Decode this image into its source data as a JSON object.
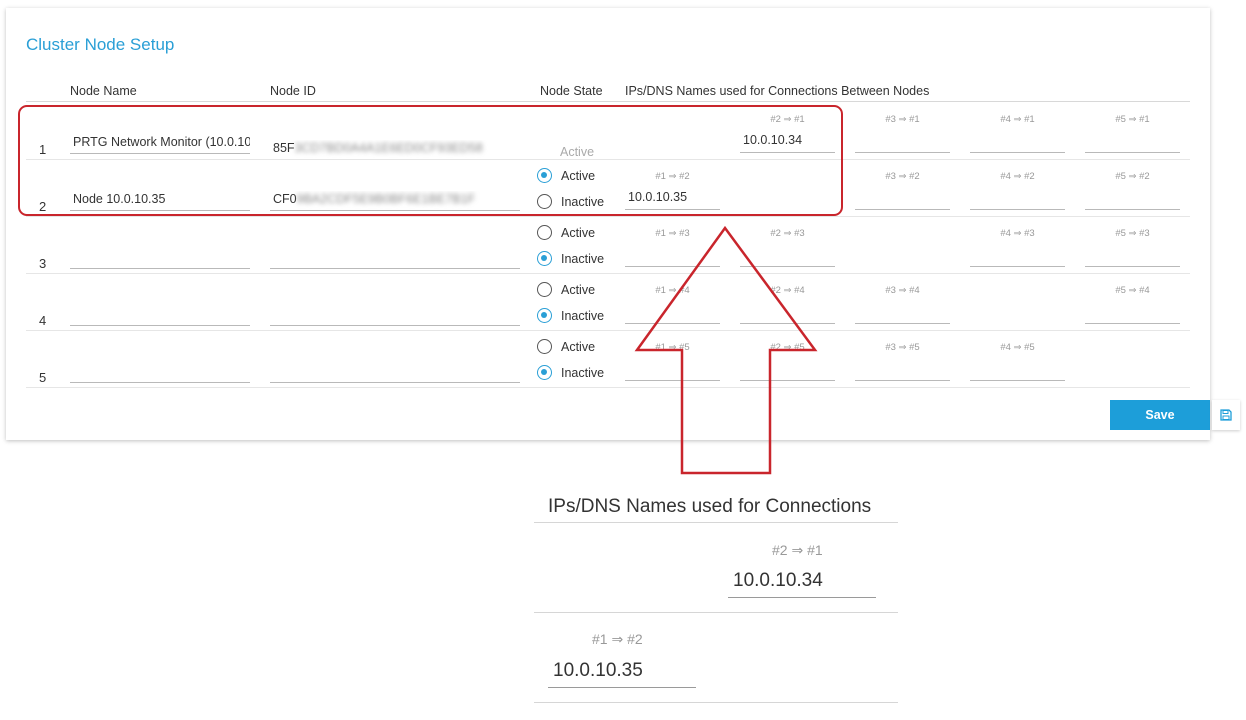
{
  "panel": {
    "title": "Cluster Node Setup",
    "headers": {
      "node_name": "Node Name",
      "node_id": "Node ID",
      "node_state": "Node State",
      "connections": "IPs/DNS Names used for Connections Between Nodes"
    },
    "rows": [
      {
        "num": "1",
        "name": "PRTG Network Monitor (10.0.10",
        "id_prefix": "85F",
        "id_rest": "3CD7BD0A4A1E6ED0CF93ED58",
        "state_static": "Active"
      },
      {
        "num": "2",
        "name": "Node 10.0.10.35",
        "id_prefix": "CF0",
        "id_rest": "9BA2CDF5E9B0BF6E1BE7B1F",
        "state": {
          "active": "Active",
          "inactive": "Inactive"
        }
      },
      {
        "num": "3",
        "name": "",
        "id_prefix": "",
        "state": {
          "active": "Active",
          "inactive": "Inactive"
        }
      },
      {
        "num": "4",
        "name": "",
        "id_prefix": "",
        "state": {
          "active": "Active",
          "inactive": "Inactive"
        }
      },
      {
        "num": "5",
        "name": "",
        "id_prefix": "",
        "state": {
          "active": "Active",
          "inactive": "Inactive"
        }
      }
    ],
    "connections": {
      "r1": {
        "c2": "#2 ⇒ #1",
        "c2v": "10.0.10.34",
        "c3": "#3 ⇒ #1",
        "c4": "#4 ⇒ #1",
        "c5": "#5 ⇒ #1"
      },
      "r2": {
        "c1": "#1 ⇒ #2",
        "c1v": "10.0.10.35",
        "c3": "#3 ⇒ #2",
        "c4": "#4 ⇒ #2",
        "c5": "#5 ⇒ #2"
      },
      "r3": {
        "c1": "#1 ⇒ #3",
        "c2": "#2 ⇒ #3",
        "c4": "#4 ⇒ #3",
        "c5": "#5 ⇒ #3"
      },
      "r4": {
        "c1": "#1 ⇒ #4",
        "c2": "#2 ⇒ #4",
        "c3": "#3 ⇒ #4",
        "c5": "#5 ⇒ #4"
      },
      "r5": {
        "c1": "#1 ⇒ #5",
        "c2": "#2 ⇒ #5",
        "c3": "#3 ⇒ #5",
        "c4": "#4 ⇒ #5"
      }
    },
    "save_label": "Save"
  },
  "zoom": {
    "header": "IPs/DNS Names used for Connections",
    "label_a": "#2 ⇒ #1",
    "value_a": "10.0.10.34",
    "label_b": "#1 ⇒ #2",
    "value_b": "10.0.10.35"
  },
  "colors": {
    "accent": "#2a9fd6",
    "button": "#1d9ed9",
    "annotation": "#c9252c"
  },
  "icons": {
    "save": "floppy-disk-icon",
    "arrow": "up-arrow-annotation"
  }
}
